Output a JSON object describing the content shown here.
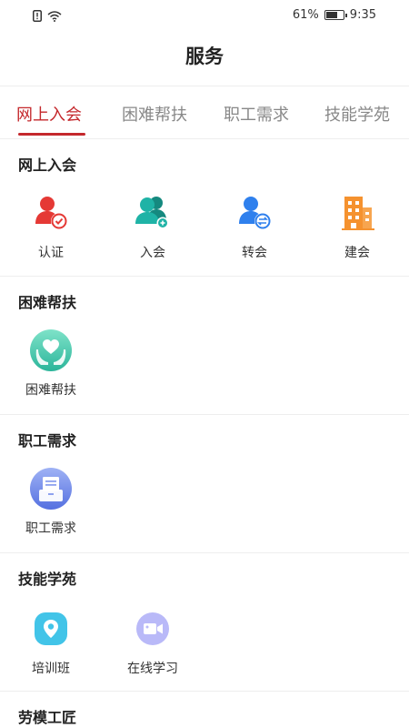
{
  "status_bar": {
    "battery": "61%",
    "time": "9:35"
  },
  "header": {
    "title": "服务"
  },
  "tabs": [
    {
      "label": "网上入会",
      "active": true
    },
    {
      "label": "困难帮扶",
      "active": false
    },
    {
      "label": "职工需求",
      "active": false
    },
    {
      "label": "技能学苑",
      "active": false
    }
  ],
  "sections": {
    "online_join": {
      "title": "网上入会",
      "items": [
        {
          "label": "认证",
          "icon": "user-verified-icon"
        },
        {
          "label": "入会",
          "icon": "add-member-icon"
        },
        {
          "label": "转会",
          "icon": "transfer-member-icon"
        },
        {
          "label": "建会",
          "icon": "building-icon"
        }
      ]
    },
    "hardship": {
      "title": "困难帮扶",
      "items": [
        {
          "label": "困难帮扶",
          "icon": "heart-hands-icon"
        }
      ]
    },
    "worker_needs": {
      "title": "职工需求",
      "items": [
        {
          "label": "职工需求",
          "icon": "document-tray-icon"
        }
      ]
    },
    "skills": {
      "title": "技能学苑",
      "items": [
        {
          "label": "培训班",
          "icon": "location-pin-icon"
        },
        {
          "label": "在线学习",
          "icon": "video-camera-icon"
        }
      ]
    },
    "model_workers": {
      "title": "劳模工匠"
    }
  },
  "colors": {
    "accent": "#c4282c",
    "verify_red": "#e53935",
    "teal": "#1fb3a6",
    "blue": "#2f80ed",
    "orange": "#f5922f",
    "cyan": "#42c4e8",
    "lavender": "#8e8ef5"
  }
}
